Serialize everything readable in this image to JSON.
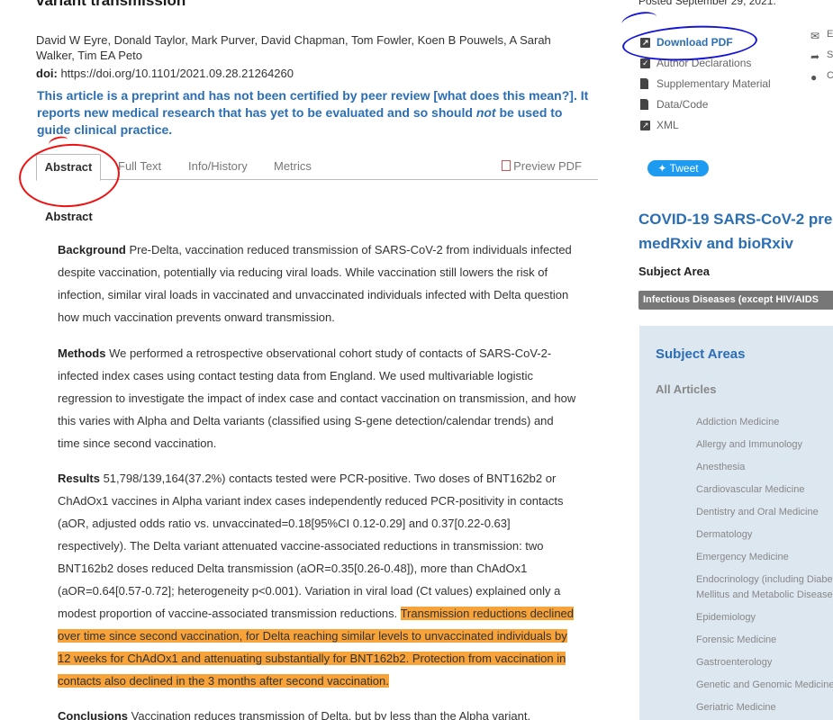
{
  "article": {
    "title": "variant transmission",
    "authors": "David W Eyre, Donald Taylor, Mark Purver, David Chapman, Tom Fowler, Koen B Pouwels, A Sarah Walker, Tim EA Peto",
    "doi_label": "doi:",
    "doi_value": "https://doi.org/10.1101/2021.09.28.21264260",
    "disclaimer_part1": "This article is a preprint and has not been certified by peer review [",
    "disclaimer_link": "what does this mean?",
    "disclaimer_part2": "]. It reports new medical research that has yet to be evaluated and so should ",
    "disclaimer_emph": "not",
    "disclaimer_part3": " be used to guide clinical practice."
  },
  "tabs": {
    "abstract": "Abstract",
    "full_text": "Full Text",
    "info_history": "Info/History",
    "metrics": "Metrics",
    "preview_pdf": "Preview PDF"
  },
  "abstract": {
    "heading": "Abstract",
    "background_label": "Background",
    "background_text": " Pre-Delta, vaccination reduced transmission of SARS-CoV-2 from individuals infected despite vaccination, potentially via reducing viral loads. While vaccination still lowers the risk of infection, similar viral loads in vaccinated and unvaccinated individuals infected with Delta question how much vaccination prevents onward transmission.",
    "methods_label": "Methods",
    "methods_text": " We performed a retrospective observational cohort study of contacts of SARS-CoV-2-infected index cases using contact testing data from England. We used multivariable logistic regression to investigate the impact of index case and contact vaccination on transmission, and how this varies with Alpha and Delta variants (classified using S-gene detection/calendar trends) and time since second vaccination.",
    "results_label": "Results",
    "results_text": " 51,798/139,164(37.2%) contacts tested were PCR-positive. Two doses of BNT162b2 or ChAdOx1 vaccines in Alpha variant index cases independently reduced PCR-positivity in contacts (aOR, adjusted odds ratio vs. unvaccinated=0.18[95%CI 0.12-0.29] and 0.37[0.22-0.63] respectively). The Delta variant attenuated vaccine-associated reductions in transmission: two BNT162b2 doses reduced Delta transmission (aOR=0.35[0.26-0.48]), more than ChAdOx1 (aOR=0.64[0.57-0.72]; heterogeneity p<0.001). Variation in viral load (Ct values) explained only a modest proportion of vaccine-associated transmission reductions. ",
    "results_highlight": "Transmission reductions declined over time since second vaccination, for Delta reaching similar levels to unvaccinated individuals by 12 weeks for ChAdOx1 and attenuating substantially for BNT162b2. Protection from vaccination in contacts also declined in the 3 months after second vaccination.",
    "conclusions_label": "Conclusions",
    "conclusions_text": " Vaccination reduces transmission of Delta, but by less than the Alpha variant."
  },
  "sidebar": {
    "posted": "Posted September 29, 2021.",
    "links": [
      {
        "label": "Download PDF",
        "icon": "external-link-icon"
      },
      {
        "label": "Author Declarations",
        "icon": "checkbox-icon"
      },
      {
        "label": "Supplementary Material",
        "icon": "document-icon"
      },
      {
        "label": "Data/Code",
        "icon": "external-link-icon"
      },
      {
        "label": "XML",
        "icon": "external-link-icon"
      }
    ],
    "edge_links": [
      "E",
      "S",
      "C"
    ],
    "tweet": "Tweet",
    "covid_title_line1": "COVID-19 SARS-CoV-2 pre",
    "covid_title_line2": "medRxiv and bioRxiv",
    "subject_area_label": "Subject Area",
    "subject_area_value": "Infectious Diseases (except HIV/AIDS",
    "areas_title": "Subject Areas",
    "areas_all": "All Articles",
    "areas": [
      "Addiction Medicine",
      "Allergy and Immunology",
      "Anesthesia",
      "Cardiovascular Medicine",
      "Dentistry and Oral Medicine",
      "Dermatology",
      "Emergency Medicine",
      "Endocrinology (including Diabetes Mellitus and Metabolic Disease)",
      "Epidemiology",
      "Forensic Medicine",
      "Gastroenterology",
      "Genetic and Genomic Medicine",
      "Geriatric Medicine"
    ]
  },
  "colors": {
    "link_blue": "#2b6eb3",
    "highlight": "#f7a339",
    "annotation_red": "#e11111",
    "annotation_blue": "#1515d8",
    "tweet_blue": "#1d9bf0",
    "sidebar_box": "#dde7f0"
  }
}
